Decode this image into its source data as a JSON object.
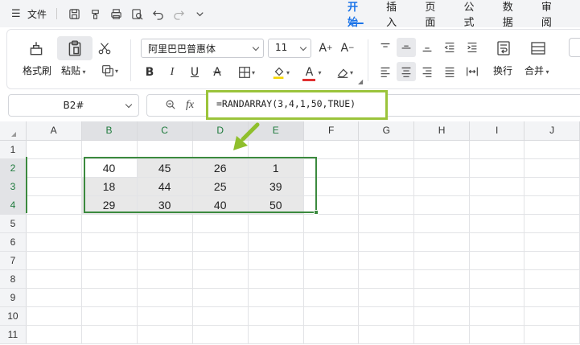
{
  "menubar": {
    "menu_icon": "hamburger-icon",
    "file_label": "文件",
    "quick_access": [
      "save-icon",
      "format-painter-icon",
      "print-icon",
      "print-preview-icon",
      "undo-icon",
      "redo-icon",
      "more-icon"
    ],
    "tabs": [
      {
        "label": "开始",
        "active": true
      },
      {
        "label": "插入",
        "active": false
      },
      {
        "label": "页面",
        "active": false
      },
      {
        "label": "公式",
        "active": false
      },
      {
        "label": "数据",
        "active": false
      },
      {
        "label": "审阅",
        "active": false
      }
    ]
  },
  "ribbon": {
    "format_painter_label": "格式刷",
    "paste_label": "粘贴",
    "font_name": "阿里巴巴普惠体",
    "font_size": "11",
    "wrap_label": "换行",
    "merge_label": "合并",
    "bold": "B",
    "italic": "I",
    "underline": "U",
    "strike": "A",
    "grow": "A",
    "shrink": "A",
    "font_color_letter": "A",
    "accent_yellow": "#f5d600",
    "accent_red": "#e03131"
  },
  "formula_bar": {
    "name_box": "B2#",
    "formula": "=RANDARRAY(3,4,1,50,TRUE)",
    "highlight_color": "#9bc43b"
  },
  "grid": {
    "columns": [
      "A",
      "B",
      "C",
      "D",
      "E",
      "F",
      "G",
      "H",
      "I",
      "J"
    ],
    "selected_columns": [
      "B",
      "C",
      "D",
      "E"
    ],
    "rows": [
      "1",
      "2",
      "3",
      "4",
      "5",
      "6",
      "7",
      "8",
      "9",
      "10",
      "11"
    ],
    "selected_rows": [
      "2",
      "3",
      "4"
    ],
    "data": [
      [
        "",
        "",
        "",
        "",
        "",
        "",
        "",
        "",
        "",
        ""
      ],
      [
        "",
        "40",
        "45",
        "26",
        "1",
        "",
        "",
        "",
        "",
        ""
      ],
      [
        "",
        "18",
        "44",
        "25",
        "39",
        "",
        "",
        "",
        "",
        ""
      ],
      [
        "",
        "29",
        "30",
        "40",
        "50",
        "",
        "",
        "",
        "",
        ""
      ],
      [
        "",
        "",
        "",
        "",
        "",
        "",
        "",
        "",
        "",
        ""
      ],
      [
        "",
        "",
        "",
        "",
        "",
        "",
        "",
        "",
        "",
        ""
      ],
      [
        "",
        "",
        "",
        "",
        "",
        "",
        "",
        "",
        "",
        ""
      ],
      [
        "",
        "",
        "",
        "",
        "",
        "",
        "",
        "",
        "",
        ""
      ],
      [
        "",
        "",
        "",
        "",
        "",
        "",
        "",
        "",
        "",
        ""
      ],
      [
        "",
        "",
        "",
        "",
        "",
        "",
        "",
        "",
        "",
        ""
      ],
      [
        "",
        "",
        "",
        "",
        "",
        "",
        "",
        "",
        "",
        ""
      ]
    ],
    "selection_color": "#3b8a3e"
  }
}
